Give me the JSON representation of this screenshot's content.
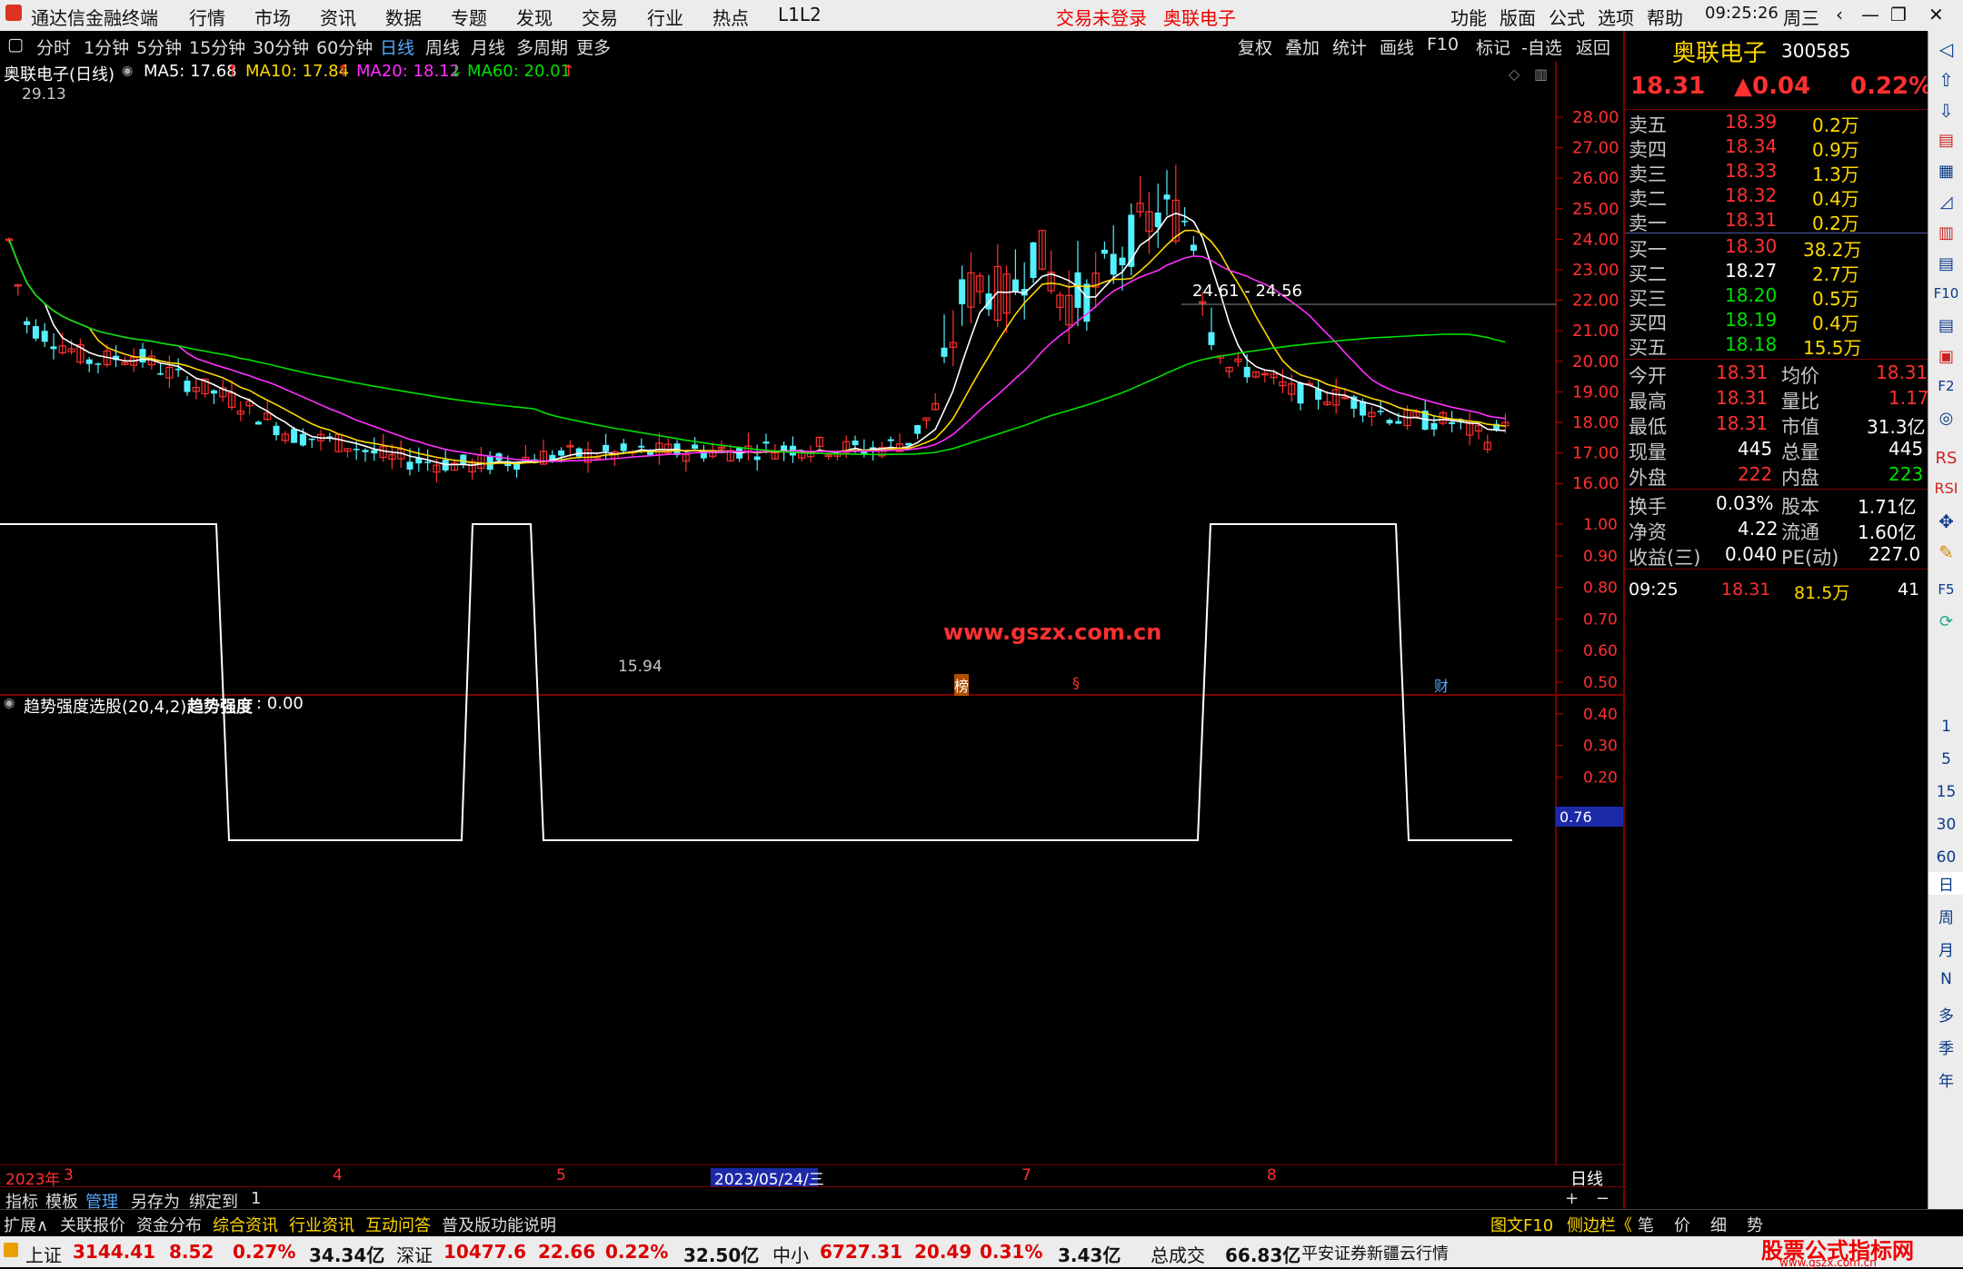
{
  "menu": {
    "app_title": "通达信金融终端",
    "items": [
      "行情",
      "市场",
      "资讯",
      "数据",
      "专题",
      "发现",
      "交易",
      "行业",
      "热点",
      "L1L2"
    ],
    "login_status": "交易未登录",
    "stock_name": "奥联电子",
    "right": [
      "功能",
      "版面",
      "公式",
      "选项",
      "帮助"
    ],
    "time": "09:25:26",
    "weekday": "周三"
  },
  "toolbar": {
    "periods": [
      "分时",
      "1分钟",
      "5分钟",
      "15分钟",
      "30分钟",
      "60分钟",
      "日线",
      "周线",
      "月线",
      "多周期",
      "更多"
    ],
    "active": "日线",
    "tools": [
      "复权",
      "叠加",
      "统计",
      "画线",
      "F10",
      "标记",
      "-自选",
      "返回"
    ]
  },
  "main_chart": {
    "title": "奥联电子(日线)",
    "ma": [
      {
        "label": "MA5: 17.68",
        "color": "#ffffff",
        "arrow": "↑"
      },
      {
        "label": "MA10: 17.84",
        "color": "#ffd800",
        "arrow": "↑"
      },
      {
        "label": "MA20: 18.12",
        "color": "#ff30ff",
        "arrow": "↓"
      },
      {
        "label": "MA60: 20.01",
        "color": "#00e000",
        "arrow": "↑"
      }
    ],
    "y_ticks": [
      "28.00",
      "27.00",
      "26.00",
      "25.00",
      "24.00",
      "23.00",
      "22.00",
      "21.00",
      "20.00",
      "19.00",
      "18.00",
      "17.00",
      "16.00"
    ],
    "high_mark": "29.13",
    "low_mark": "15.94",
    "range_label": "24.61 - 24.56",
    "watermark": "www.gszx.com.cn",
    "markers": [
      "榜",
      "§",
      "财"
    ]
  },
  "chart_data": {
    "type": "line",
    "title": "趋势强度选股(20,4,2)",
    "series": [
      {
        "name": "趋势强度",
        "latest": "0.00"
      }
    ],
    "ylim": [
      0,
      1
    ],
    "y_ticks": [
      "1.00",
      "0.90",
      "0.80",
      "0.70",
      "0.60",
      "0.50",
      "0.40",
      "0.30",
      "0.20"
    ],
    "cursor_value": "0.76",
    "segments": [
      {
        "value": 1,
        "span": "Feb–early Mar 2023"
      },
      {
        "value": 0,
        "span": "Mar–Apr 2023"
      },
      {
        "value": 1,
        "span": "late Apr 2023"
      },
      {
        "value": 0,
        "span": "May–Jul 2023"
      },
      {
        "value": 1,
        "span": "late Jul–Aug 2023"
      },
      {
        "value": 0,
        "span": "Sep 2023"
      }
    ],
    "x_labels": [
      "2023年",
      "3",
      "4",
      "5",
      "2023/05/24/三",
      "7",
      "8"
    ],
    "period": "日线"
  },
  "quote": {
    "name": "奥联电子",
    "code": "300585",
    "price": "18.31",
    "change": "▲0.04",
    "pct": "0.22%",
    "sells": [
      [
        "卖五",
        "18.39",
        "0.2万"
      ],
      [
        "卖四",
        "18.34",
        "0.9万"
      ],
      [
        "卖三",
        "18.33",
        "1.3万"
      ],
      [
        "卖二",
        "18.32",
        "0.4万"
      ],
      [
        "卖一",
        "18.31",
        "0.2万"
      ]
    ],
    "buys": [
      [
        "买一",
        "18.30",
        "38.2万"
      ],
      [
        "买二",
        "18.27",
        "2.7万"
      ],
      [
        "买三",
        "18.20",
        "0.5万"
      ],
      [
        "买四",
        "18.19",
        "0.4万"
      ],
      [
        "买五",
        "18.18",
        "15.5万"
      ]
    ],
    "stats": [
      [
        "今开",
        "18.31",
        "均价",
        "18.31"
      ],
      [
        "最高",
        "18.31",
        "量比",
        "1.17"
      ],
      [
        "最低",
        "18.31",
        "市值",
        "31.3亿"
      ],
      [
        "现量",
        "445",
        "总量",
        "445"
      ],
      [
        "外盘",
        "222",
        "内盘",
        "223"
      ]
    ],
    "stats2": [
      [
        "换手",
        "0.03%",
        "股本",
        "1.71亿"
      ],
      [
        "净资",
        "4.22",
        "流通",
        "1.60亿"
      ],
      [
        "收益(三)",
        "0.040",
        "PE(动)",
        "227.0"
      ]
    ],
    "tick": [
      "09:25",
      "18.31",
      "81.5万",
      "41"
    ]
  },
  "right_sidebar": [
    "1",
    "5",
    "15",
    "30",
    "60",
    "日",
    "周",
    "月",
    "N",
    "多",
    "季",
    "年"
  ],
  "bottom_tabs": [
    "指标",
    "模板",
    "管理",
    "另存为",
    "绑定到",
    "1"
  ],
  "bottom_tabs2": [
    "扩展∧",
    "关联报价",
    "资金分布",
    "综合资讯",
    "行业资讯",
    "互动问答",
    "普及版功能说明"
  ],
  "bottom_right": [
    "图文F10",
    "侧边栏《",
    "笔",
    "价",
    "细",
    "势"
  ],
  "status": {
    "sh_label": "上证",
    "sh": "3144.41",
    "sh_chg": "8.52",
    "sh_pct": "0.27%",
    "sh_amt": "34.34亿",
    "sz_label": "深证",
    "sz": "10477.6",
    "sz_chg": "22.66",
    "sz_pct": "0.22%",
    "sz_amt": "32.50亿",
    "zx_label": "中小",
    "zx": "6727.31",
    "zx_chg": "20.49",
    "zx_pct": "0.31%",
    "zx_amt": "3.43亿",
    "total_label": "总成交",
    "total": "66.83亿",
    "broker": "平安证券新疆云行情",
    "logo": "股票公式指标网",
    "logo_url": "www.gszx.com.cn"
  }
}
